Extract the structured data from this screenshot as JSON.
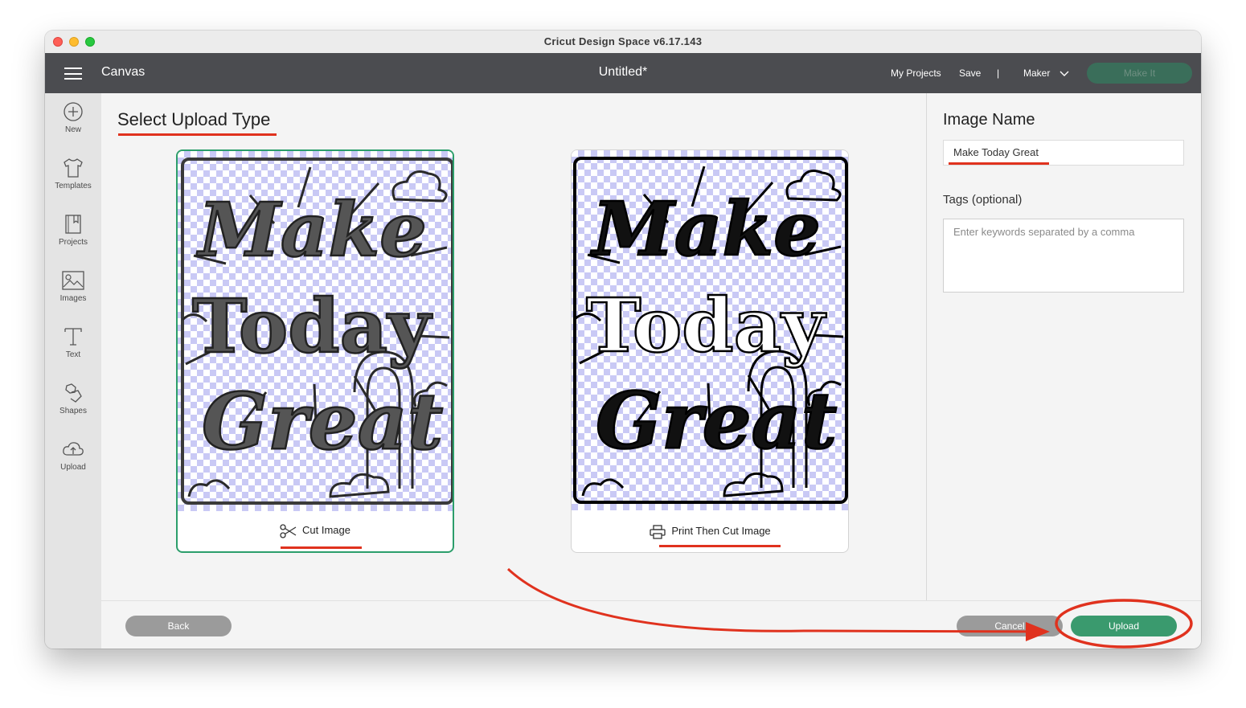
{
  "window": {
    "title": "Cricut Design Space  v6.17.143"
  },
  "header": {
    "canvas_label": "Canvas",
    "doc_title": "Untitled*",
    "my_projects": "My Projects",
    "save": "Save",
    "separator": "|",
    "machine": "Maker",
    "make_it": "Make It"
  },
  "sidebar": {
    "items": [
      {
        "label": "New",
        "icon": "plus-circle-icon"
      },
      {
        "label": "Templates",
        "icon": "tshirt-icon"
      },
      {
        "label": "Projects",
        "icon": "bookmark-book-icon"
      },
      {
        "label": "Images",
        "icon": "image-icon"
      },
      {
        "label": "Text",
        "icon": "text-t-icon"
      },
      {
        "label": "Shapes",
        "icon": "shapes-icon"
      },
      {
        "label": "Upload",
        "icon": "cloud-upload-icon"
      }
    ]
  },
  "main": {
    "title": "Select Upload Type",
    "cards": [
      {
        "label": "Cut Image",
        "icon": "scissors-icon",
        "selected": true,
        "art_words": [
          "Make",
          "Today",
          "Great"
        ]
      },
      {
        "label": "Print Then Cut Image",
        "icon": "printer-icon",
        "selected": false,
        "art_words": [
          "Make",
          "Today",
          "Great"
        ]
      }
    ]
  },
  "right_panel": {
    "image_name_label": "Image Name",
    "image_name_value": "Make Today Great",
    "tags_label": "Tags (optional)",
    "tags_placeholder": "Enter keywords separated by a comma"
  },
  "footer": {
    "back": "Back",
    "cancel": "Cancel",
    "upload": "Upload"
  },
  "colors": {
    "header_bg": "#4b4c50",
    "selected_border": "#2c9e6b",
    "upload_button": "#3a9a6e",
    "annotation_red": "#e0321e",
    "checker": "#c9c9f5"
  }
}
